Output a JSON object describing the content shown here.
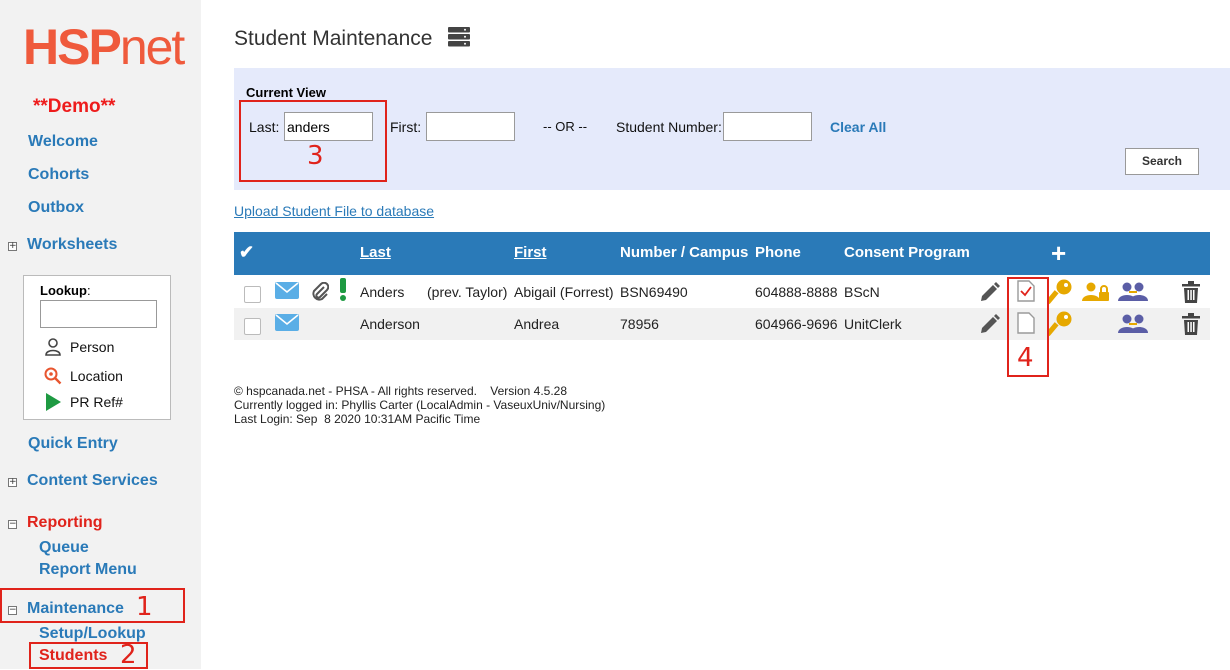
{
  "sidebar": {
    "logo_bold": "HSP",
    "logo_light": "net",
    "demo": "**Demo**",
    "nav": {
      "welcome": "Welcome",
      "cohorts": "Cohorts",
      "outbox": "Outbox",
      "worksheets": "Worksheets",
      "quick_entry": "Quick Entry",
      "content_services": "Content Services",
      "reporting": "Reporting",
      "queue": "Queue",
      "report_menu": "Report Menu",
      "maintenance": "Maintenance",
      "setup_lookup": "Setup/Lookup",
      "students": "Students"
    },
    "lookup": {
      "title": "Lookup",
      "title_suffix": ":",
      "value": "",
      "person": "Person",
      "location": "Location",
      "pr_ref": "PR Ref#"
    }
  },
  "annotations": [
    "1",
    "2",
    "3",
    "4"
  ],
  "main": {
    "title": "Student Maintenance",
    "current_view": "Current View",
    "last_label": "Last:",
    "last_value": "anders",
    "first_label": "First:",
    "first_value": "",
    "or_text": "-- OR --",
    "student_number_label": "Student Number:",
    "student_number_value": "",
    "clear_all": "Clear All",
    "search": "Search",
    "upload_link": "Upload Student File to database"
  },
  "table": {
    "headers": {
      "check": "✔",
      "last": "Last",
      "first": "First",
      "number_campus": "Number / Campus",
      "phone": "Phone",
      "consent_program": "Consent Program",
      "add": "+"
    },
    "rows": [
      {
        "last": "Anders",
        "prev": "(prev. Taylor)",
        "first": "Abigail (Forrest)",
        "number": "BSN69490",
        "phone": "604888-8888",
        "program": "BScN"
      },
      {
        "last": "Anderson",
        "prev": "",
        "first": "Andrea",
        "number": "78956",
        "phone": "604966-9696",
        "program": "UnitClerk"
      }
    ]
  },
  "footer": {
    "line1": "© hspcanada.net - PHSA - All rights reserved.    Version 4.5.28",
    "line2": "Currently logged in: Phyllis Carter (LocalAdmin - VaseuxUniv/Nursing)",
    "line3": "Last Login: Sep  8 2020 10:31AM Pacific Time"
  },
  "colors": {
    "brand": "#ef5a3c",
    "link": "#2a7ab8",
    "header_bg": "#2a7ab8",
    "panel_bg": "#e5eafb",
    "highlight": "#e0231b",
    "key_gold": "#e6a800",
    "user_purple": "#5b5ea6"
  },
  "icons": [
    "server-icon",
    "mail-icon",
    "paperclip-icon",
    "alert-icon",
    "pencil-icon",
    "checked-doc-icon",
    "doc-icon",
    "key-icon",
    "user-lock-icon",
    "users-icon",
    "trash-icon",
    "person-icon",
    "location-icon",
    "play-icon"
  ]
}
